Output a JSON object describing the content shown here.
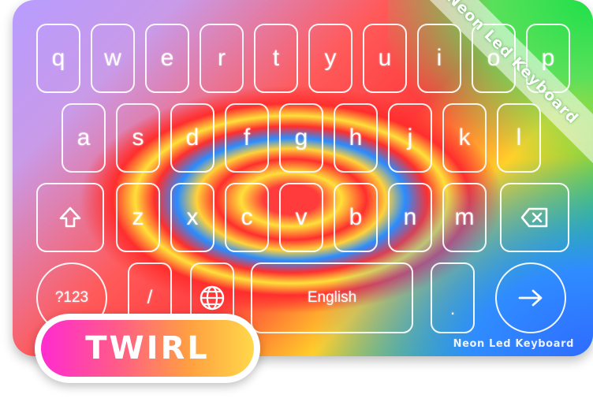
{
  "ribbon_text": "Neon Led Keyboard",
  "brand_text": "Neon Led Keyboard",
  "badge_text": "TWIRL",
  "rows": {
    "row1": [
      "q",
      "w",
      "e",
      "r",
      "t",
      "y",
      "u",
      "i",
      "o",
      "p"
    ],
    "row2": [
      "a",
      "s",
      "d",
      "f",
      "g",
      "h",
      "j",
      "k",
      "l"
    ],
    "row3": [
      "z",
      "x",
      "c",
      "v",
      "b",
      "n",
      "m"
    ]
  },
  "bottom": {
    "symbols": "?123",
    "slash": "/",
    "space": "English",
    "period": "."
  },
  "icons": {
    "shift": "shift-arrow-icon",
    "backspace": "backspace-icon",
    "globe": "globe-icon",
    "enter": "arrow-right-icon"
  },
  "colors": {
    "key_border": "#ffffff",
    "badge_gradient": [
      "#ff2bd0",
      "#ffd84a"
    ]
  }
}
